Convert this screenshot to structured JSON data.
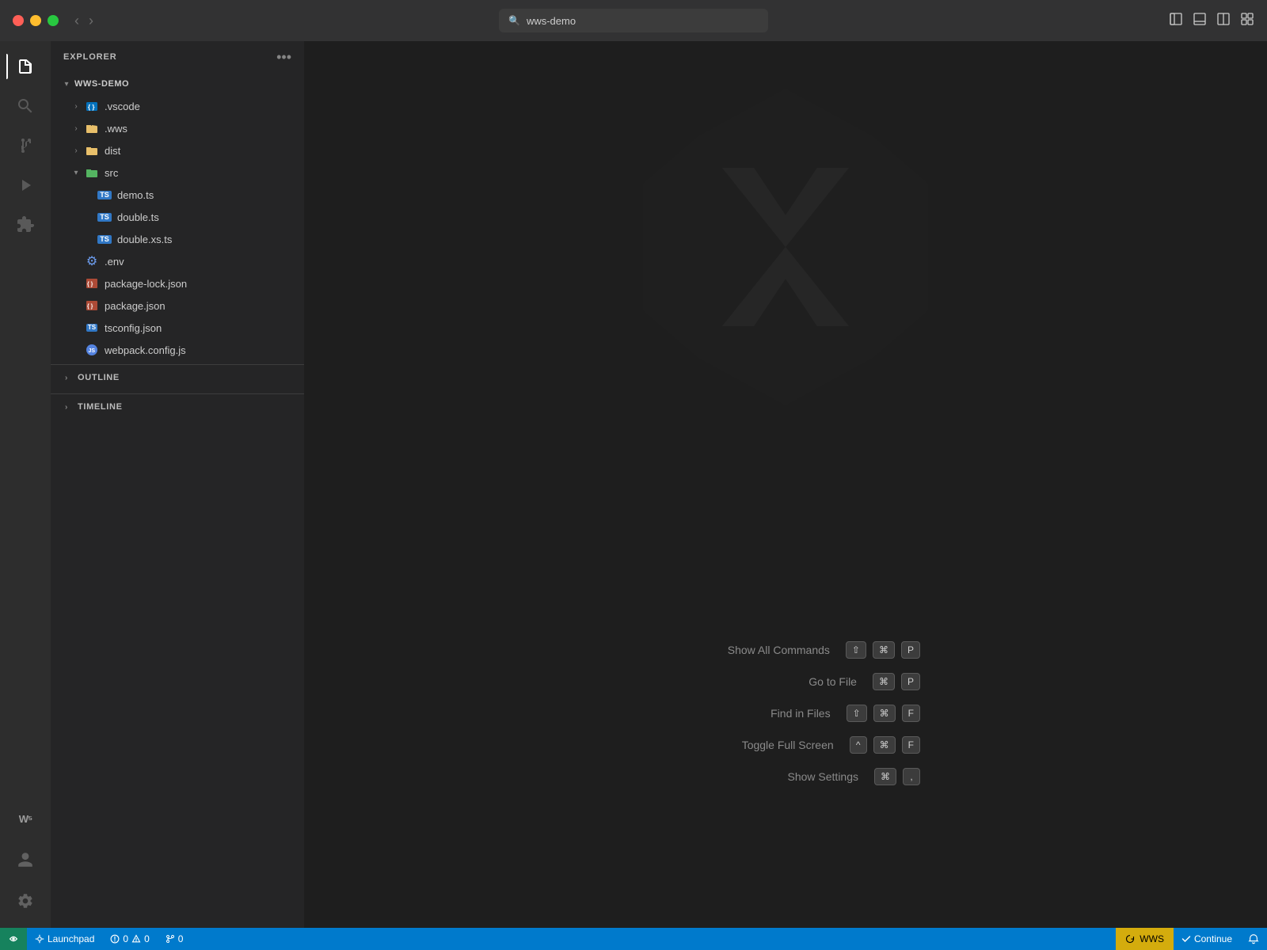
{
  "titlebar": {
    "search_text": "wws-demo",
    "nav_back": "‹",
    "nav_forward": "›"
  },
  "activity_bar": {
    "icons": [
      {
        "name": "explorer-icon",
        "symbol": "⬡",
        "active": true,
        "label": "Explorer"
      },
      {
        "name": "search-icon",
        "symbol": "🔍",
        "active": false,
        "label": "Search"
      },
      {
        "name": "source-control-icon",
        "symbol": "⑂",
        "active": false,
        "label": "Source Control"
      },
      {
        "name": "run-debug-icon",
        "symbol": "▷",
        "active": false,
        "label": "Run and Debug"
      },
      {
        "name": "extensions-icon",
        "symbol": "⊞",
        "active": false,
        "label": "Extensions"
      },
      {
        "name": "wws-icon",
        "symbol": "W⁵",
        "active": false,
        "label": "WWS"
      }
    ],
    "bottom_icons": [
      {
        "name": "account-icon",
        "symbol": "👤",
        "label": "Account"
      },
      {
        "name": "settings-icon",
        "symbol": "⚙",
        "label": "Settings"
      }
    ]
  },
  "sidebar": {
    "header": "EXPLORER",
    "more_button": "•••",
    "tree": {
      "root": {
        "label": "WWS-DEMO",
        "expanded": true,
        "children": [
          {
            "label": ".vscode",
            "type": "folder-vscode",
            "expanded": false,
            "indent": 1
          },
          {
            "label": ".wws",
            "type": "folder-yellow",
            "expanded": false,
            "indent": 1
          },
          {
            "label": "dist",
            "type": "folder-yellow",
            "expanded": false,
            "indent": 1
          },
          {
            "label": "src",
            "type": "folder-green",
            "expanded": true,
            "indent": 1,
            "children": [
              {
                "label": "demo.ts",
                "type": "ts",
                "indent": 2
              },
              {
                "label": "double.ts",
                "type": "ts",
                "indent": 2
              },
              {
                "label": "double.xs.ts",
                "type": "ts",
                "indent": 2
              }
            ]
          },
          {
            "label": ".env",
            "type": "gear",
            "indent": 1
          },
          {
            "label": "package-lock.json",
            "type": "json-lock",
            "indent": 1
          },
          {
            "label": "package.json",
            "type": "json",
            "indent": 1
          },
          {
            "label": "tsconfig.json",
            "type": "tsconfig",
            "indent": 1
          },
          {
            "label": "webpack.config.js",
            "type": "webpack",
            "indent": 1
          }
        ]
      }
    },
    "outline_label": "OUTLINE",
    "timeline_label": "TIMELINE"
  },
  "editor": {
    "shortcuts": [
      {
        "label": "Show All Commands",
        "keys": [
          "⇧",
          "⌘",
          "P"
        ]
      },
      {
        "label": "Go to File",
        "keys": [
          "⌘",
          "P"
        ]
      },
      {
        "label": "Find in Files",
        "keys": [
          "⇧",
          "⌘",
          "F"
        ]
      },
      {
        "label": "Toggle Full Screen",
        "keys": [
          "^",
          "⌘",
          "F"
        ]
      },
      {
        "label": "Show Settings",
        "keys": [
          "⌘",
          ","
        ]
      }
    ]
  },
  "statusbar": {
    "left_items": [
      {
        "name": "remote-icon",
        "text": ""
      },
      {
        "name": "launchpad-item",
        "text": "Launchpad",
        "icon": "🚀"
      },
      {
        "name": "errors-item",
        "text": "0",
        "icon": "⊗"
      },
      {
        "name": "warnings-item",
        "text": "0",
        "icon": "⚠"
      },
      {
        "name": "info-item",
        "text": "0",
        "icon": "⑂"
      }
    ],
    "wws_label": "WWS",
    "wws_icon": "↻",
    "continue_label": "Continue",
    "continue_icon": "✓"
  }
}
